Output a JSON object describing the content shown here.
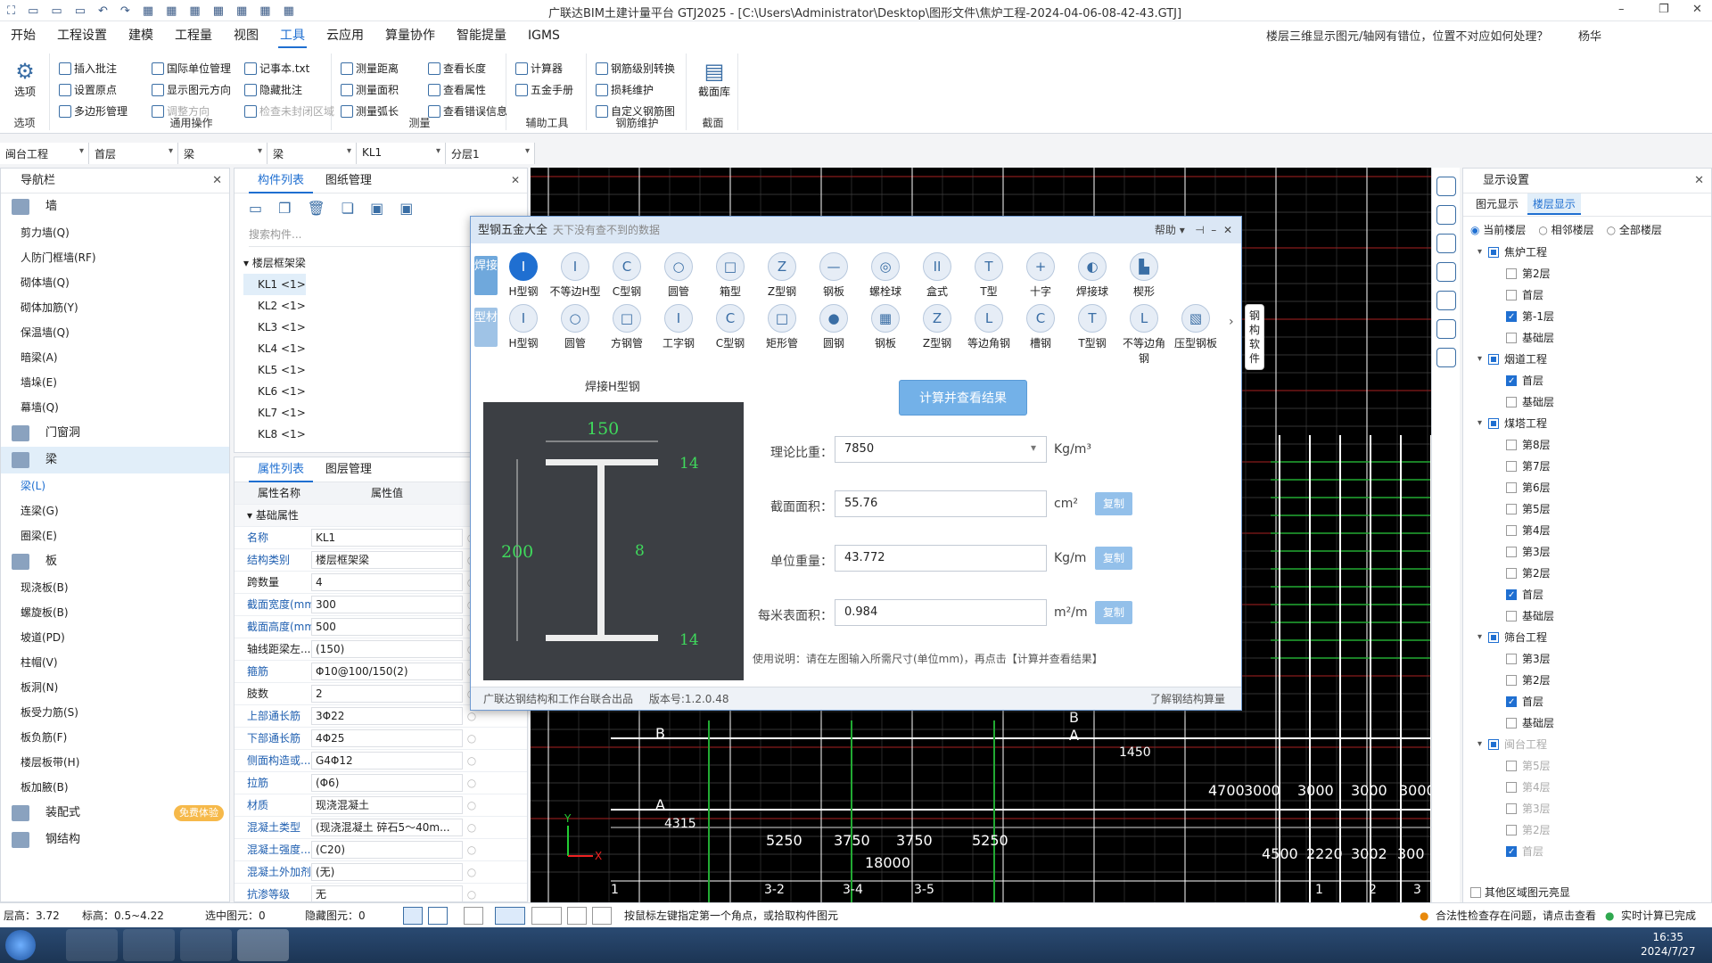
{
  "app": {
    "title": "广联达BIM土建计量平台 GTJ2025 - [C:\\Users\\Administrator\\Desktop\\图形文件\\焦炉工程-2024-04-06-08-42-43.GTJ]",
    "help_question": "楼层三维显示图元/轴网有错位，位置不对应如何处理？",
    "user": "杨华",
    "accent": "#1f6fd1"
  },
  "menu": [
    "开始",
    "工程设置",
    "建模",
    "工程量",
    "视图",
    "工具",
    "云应用",
    "算量协作",
    "智能提量",
    "IGMS"
  ],
  "menu_active": "工具",
  "ribbon": {
    "options_label": "选项",
    "options_group": "选项",
    "general": {
      "title": "通用操作",
      "items": [
        "插入批注",
        "设置原点",
        "多边形管理",
        "国际单位管理",
        "显示图元方向",
        "调整方向",
        "记事本.txt",
        "隐藏批注",
        "检查未封闭区域"
      ]
    },
    "measure": {
      "title": "测量",
      "items": [
        "测量距离",
        "测量面积",
        "测量弧长",
        "查看长度",
        "查看属性",
        "查看错误信息"
      ]
    },
    "aux": {
      "title": "辅助工具",
      "items": [
        "计算器",
        "五金手册"
      ]
    },
    "rebar": {
      "title": "钢筋维护",
      "items": [
        "钢筋级别转换",
        "损耗维护",
        "自定义钢筋图"
      ]
    },
    "section": {
      "title": "截面",
      "label": "截面库"
    }
  },
  "combos": [
    "闽台工程",
    "首层",
    "梁",
    "梁",
    "KL1",
    "分层1"
  ],
  "nav": {
    "title": "导航栏",
    "categories": [
      {
        "name": "墙",
        "subs": [
          "剪力墙(Q)",
          "人防门框墙(RF)",
          "砌体墙(Q)",
          "砌体加筋(Y)",
          "保温墙(Q)",
          "暗梁(A)",
          "墙垛(E)",
          "幕墙(Q)"
        ]
      },
      {
        "name": "门窗洞",
        "subs": []
      },
      {
        "name": "梁",
        "subs": [
          "梁(L)",
          "连梁(G)",
          "圈梁(E)"
        ]
      },
      {
        "name": "板",
        "subs": [
          "现浇板(B)",
          "螺旋板(B)",
          "坡道(PD)",
          "柱帽(V)",
          "板洞(N)",
          "板受力筋(S)",
          "板负筋(F)",
          "楼层板带(H)",
          "板加腋(B)"
        ]
      },
      {
        "name": "装配式",
        "subs": [],
        "badge": "免费体验"
      },
      {
        "name": "钢结构",
        "subs": []
      }
    ]
  },
  "components": {
    "tabs": [
      "构件列表",
      "图纸管理"
    ],
    "search_placeholder": "搜索构件...",
    "group": "楼层框架梁",
    "items": [
      "KL1 <1>",
      "KL2 <1>",
      "KL3 <1>",
      "KL4 <1>",
      "KL5 <1>",
      "KL6 <1>",
      "KL7 <1>",
      "KL8 <1>"
    ]
  },
  "properties": {
    "tabs": [
      "属性列表",
      "图层管理"
    ],
    "col_name": "属性名称",
    "col_value": "属性值",
    "section": "基础属性",
    "rows": [
      {
        "n": "名称",
        "v": "KL1"
      },
      {
        "n": "结构类别",
        "v": "楼层框架梁"
      },
      {
        "n": "跨数量",
        "v": "4"
      },
      {
        "n": "截面宽度(mm)",
        "v": "300"
      },
      {
        "n": "截面高度(mm)",
        "v": "500"
      },
      {
        "n": "轴线距梁左...",
        "v": "(150)"
      },
      {
        "n": "箍筋",
        "v": "Φ10@100/150(2)"
      },
      {
        "n": "肢数",
        "v": "2"
      },
      {
        "n": "上部通长筋",
        "v": "3Φ22"
      },
      {
        "n": "下部通长筋",
        "v": "4Φ25"
      },
      {
        "n": "侧面构造或...",
        "v": "G4Φ12"
      },
      {
        "n": "拉筋",
        "v": "(Φ6)"
      },
      {
        "n": "材质",
        "v": "现浇混凝土"
      },
      {
        "n": "混凝土类型",
        "v": "(现浇混凝土 碎石5～40m..."
      },
      {
        "n": "混凝土强度...",
        "v": "(C20)"
      },
      {
        "n": "混凝土外加剂",
        "v": "(无)"
      },
      {
        "n": "抗渗等级",
        "v": "无"
      }
    ]
  },
  "display": {
    "title": "显示设置",
    "tabs": [
      "图元显示",
      "楼层显示"
    ],
    "radios": [
      "当前楼层",
      "相邻楼层",
      "全部楼层"
    ],
    "projects": [
      {
        "name": "焦炉工程",
        "floors": [
          {
            "n": "第2层",
            "c": false
          },
          {
            "n": "首层",
            "c": false
          },
          {
            "n": "第-1层",
            "c": true
          },
          {
            "n": "基础层",
            "c": false
          }
        ]
      },
      {
        "name": "烟道工程",
        "floors": [
          {
            "n": "首层",
            "c": true
          },
          {
            "n": "基础层",
            "c": false
          }
        ]
      },
      {
        "name": "煤塔工程",
        "floors": [
          {
            "n": "第8层",
            "c": false
          },
          {
            "n": "第7层",
            "c": false
          },
          {
            "n": "第6层",
            "c": false
          },
          {
            "n": "第5层",
            "c": false
          },
          {
            "n": "第4层",
            "c": false
          },
          {
            "n": "第3层",
            "c": false
          },
          {
            "n": "第2层",
            "c": false
          },
          {
            "n": "首层",
            "c": true
          },
          {
            "n": "基础层",
            "c": false
          }
        ]
      },
      {
        "name": "筛台工程",
        "floors": [
          {
            "n": "第3层",
            "c": false
          },
          {
            "n": "第2层",
            "c": false
          },
          {
            "n": "首层",
            "c": true
          },
          {
            "n": "基础层",
            "c": false
          }
        ]
      },
      {
        "name": "闽台工程",
        "floors": [
          {
            "n": "第5层",
            "c": false
          },
          {
            "n": "第4层",
            "c": false
          },
          {
            "n": "第3层",
            "c": false
          },
          {
            "n": "第2层",
            "c": false
          },
          {
            "n": "首层",
            "c": true
          }
        ],
        "grey": true
      }
    ],
    "footer": "其他区域图元亮显"
  },
  "dialog": {
    "title": "型钢五金大全",
    "subtitle": "天下没有查不到的数据",
    "help": "帮助",
    "tab_weld": "焊接",
    "tab_profile": "型材",
    "row1": [
      "H型钢",
      "不等边H型",
      "C型钢",
      "圆管",
      "箱型",
      "Z型钢",
      "钢板",
      "螺栓球",
      "盒式",
      "T型",
      "十字",
      "焊接球",
      "楔形"
    ],
    "row2": [
      "H型钢",
      "圆管",
      "方钢管",
      "工字钢",
      "C型钢",
      "矩形管",
      "圆钢",
      "钢板",
      "Z型钢",
      "等边角钢",
      "槽钢",
      "T型钢",
      "不等边角钢",
      "压型钢板"
    ],
    "side_text": "钢构软件",
    "diagram_title": "焊接H型钢",
    "dims": {
      "width": "150",
      "height": "200",
      "flange_top": "14",
      "flange_bottom": "14",
      "web": "8"
    },
    "calc_button": "计算并查看结果",
    "fields": [
      {
        "label": "理论比重：",
        "value": "7850",
        "unit": "Kg/m³",
        "copy": ""
      },
      {
        "label": "截面面积：",
        "value": "55.76",
        "unit": "cm²",
        "copy": "复制"
      },
      {
        "label": "单位重量：",
        "value": "43.772",
        "unit": "Kg/m",
        "copy": "复制"
      },
      {
        "label": "每米表面积：",
        "value": "0.984",
        "unit": "m²/m",
        "copy": "复制"
      }
    ],
    "usage": "使用说明：请在左图输入所需尺寸(单位mm)，再点击【计算并查看结果】",
    "footer_left": "广联达钢结构和工作台联合出品",
    "version": "版本号:1.2.0.48",
    "footer_right": "了解钢结构算量"
  },
  "cad": {
    "axis_labels": [
      "B",
      "A",
      "B",
      "A"
    ],
    "dims": [
      "4315",
      "5250",
      "3750",
      "3750",
      "5250",
      "18000",
      "4500",
      "2220",
      "3002",
      "300",
      "4700",
      "3000",
      "3000",
      "3000",
      "3000",
      "1450"
    ],
    "grid_nums": [
      "1",
      "3-2",
      "3-4",
      "3-5",
      "1",
      "2",
      "3"
    ],
    "x_label": "X",
    "y_label": "Y"
  },
  "status": {
    "floor_height": "层高：3.72",
    "elevation": "标高：0.5~4.22",
    "selected": "选中图元：0",
    "hidden": "隐藏图元：0",
    "hint": "按鼠标左键指定第一个角点，或拾取构件图元",
    "check": "合法性检查存在问题，请点击查看",
    "realtime": "实时计算已完成"
  },
  "taskbar": {
    "time": "16:35",
    "date": "2024/7/27"
  }
}
